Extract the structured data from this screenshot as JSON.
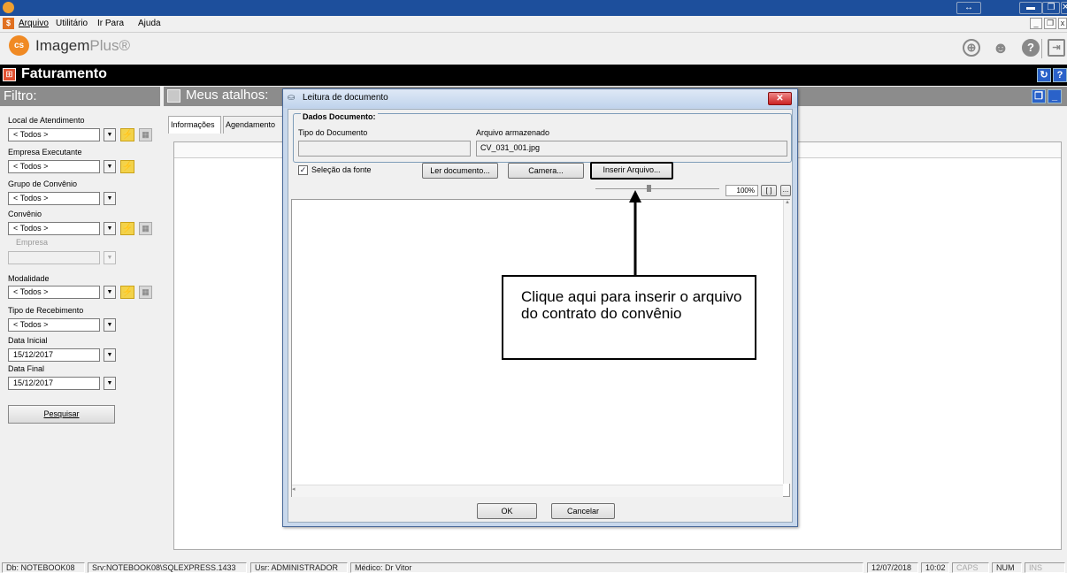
{
  "window": {
    "title": "",
    "controls": [
      "▬",
      "❐",
      "✕"
    ]
  },
  "menu": {
    "items": [
      "Arquivo",
      "Utilitário",
      "Ir Para",
      "Ajuda"
    ]
  },
  "brand": {
    "logo_text": "cs",
    "name_dark": "Imagem",
    "name_light": "Plus®"
  },
  "module": {
    "title": "Faturamento"
  },
  "filter": {
    "header": "Filtro:",
    "local_label": "Local de Atendimento",
    "local_value": "< Todos >",
    "empresa_exec_label": "Empresa Executante",
    "empresa_exec_value": "< Todos >",
    "grupo_label": "Grupo de Convênio",
    "grupo_value": "< Todos >",
    "convenio_label": "Convênio",
    "convenio_value": "< Todos >",
    "empresa_label": "Empresa",
    "empresa_value": "",
    "modalidade_label": "Modalidade",
    "modalidade_value": "< Todos >",
    "tipo_receb_label": "Tipo de Recebimento",
    "tipo_receb_value": "< Todos >",
    "data_inicial_label": "Data Inicial",
    "data_inicial_value": "15/12/2017",
    "data_final_label": "Data Final",
    "data_final_value": "15/12/2017",
    "pesquisar": "Pesquisar"
  },
  "shortcuts": {
    "header": "Meus atalhos:"
  },
  "tabs": {
    "informacoes": "Informações",
    "agendamento": "Agendamento"
  },
  "dialog": {
    "title": "Leitura de documento",
    "group_label": "Dados Documento:",
    "tipo_label": "Tipo do Documento",
    "tipo_value": "",
    "arquivo_label": "Arquivo armazenado",
    "arquivo_value": "CV_031_001.jpg",
    "selecao_label": "Seleção da fonte",
    "selecao_checked": true,
    "ler_btn": "Ler documento...",
    "camera_btn": "Camera...",
    "inserir_btn": "Inserir Arquivo...",
    "zoom": "100%",
    "zoom_fit": "[ ]",
    "zoom_more": "...",
    "ok_btn": "OK",
    "cancel_btn": "Cancelar"
  },
  "callout": {
    "text": "Clique aqui para inserir o arquivo do contrato do convênio"
  },
  "status": {
    "db": "Db: NOTEBOOK08",
    "srv": "Srv:NOTEBOOK08\\SQLEXPRESS.1433",
    "usr": "Usr: ADMINISTRADOR",
    "medico": "Médico: Dr Vitor",
    "date": "12/07/2018",
    "time": "10:02",
    "caps": "CAPS",
    "num": "NUM",
    "ins": "INS"
  },
  "colors": {
    "titlebar": "#1d4f9c",
    "accent": "#f08a24",
    "module_bar": "#000000",
    "filter_bar": "#8c8c8c",
    "dialog_frame": "#c8d8ec"
  },
  "icons": {
    "globe": "globe-icon",
    "support": "support-icon",
    "help": "help-icon",
    "exit": "exit-icon",
    "lightning": "lightning-icon"
  }
}
